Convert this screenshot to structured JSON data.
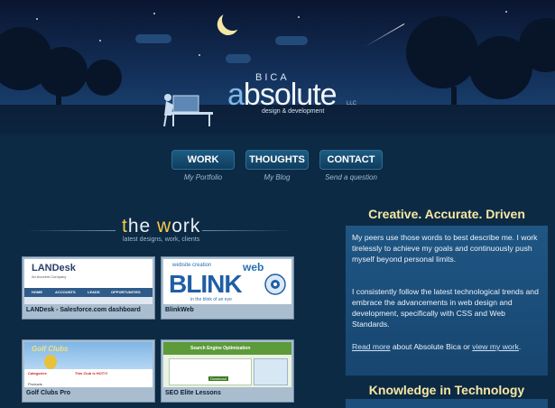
{
  "header": {
    "logo_small": "BICA",
    "logo_main_a": "a",
    "logo_main_rest": "bsolute",
    "logo_llc": "LLC",
    "logo_tagline": "design & development"
  },
  "nav": [
    {
      "label": "WORK",
      "sub": "My Portfolio"
    },
    {
      "label": "THOUGHTS",
      "sub": "My Blog"
    },
    {
      "label": "CONTACT",
      "sub": "Send a question"
    }
  ],
  "work": {
    "title_first": "t",
    "title_he": "he ",
    "title_w": "w",
    "title_ork": "ork",
    "subtitle": "latest designs, work, clients"
  },
  "portfolio": [
    {
      "caption": "LANDesk - Salesforce.com dashboard",
      "brand": "LANDesk",
      "brand_sub": "An Avocent Company",
      "tabs": [
        "HOME",
        "ACCOUNTS",
        "LEADS",
        "OPPORTUNITIES"
      ]
    },
    {
      "caption": "BlinkWeb",
      "line1": "website creation",
      "line2": "web",
      "big": "BLINK",
      "line3": "in the blink of an eye"
    },
    {
      "caption": "Golf Clubs Pro",
      "brand": "Golf Clubs",
      "hot": "This Club is HOT!!!",
      "cat": "Categories",
      "prod": "Products"
    },
    {
      "caption": "SEO Elite Lessons",
      "head": "Search Engine Optimization",
      "btn": "Download"
    }
  ],
  "sidebar": {
    "title": "Creative. Accurate. Driven",
    "p1": "My peers use those words to best describe me. I work tirelessly to achieve my goals and continuously push myself beyond personal limits.",
    "p2": "I consistently follow the latest technological trends and embrace the advancements in web design and development, specifically with CSS and Web Standards.",
    "read_more": "Read more",
    "p3_mid": " about Absolute Bica or ",
    "view_work": "view my work",
    "p3_end": ".",
    "title2": "Knowledge in Technology"
  },
  "colors": {
    "accent": "#f6c945",
    "background": "#0d2a45",
    "sidebar": "#1f5684"
  }
}
